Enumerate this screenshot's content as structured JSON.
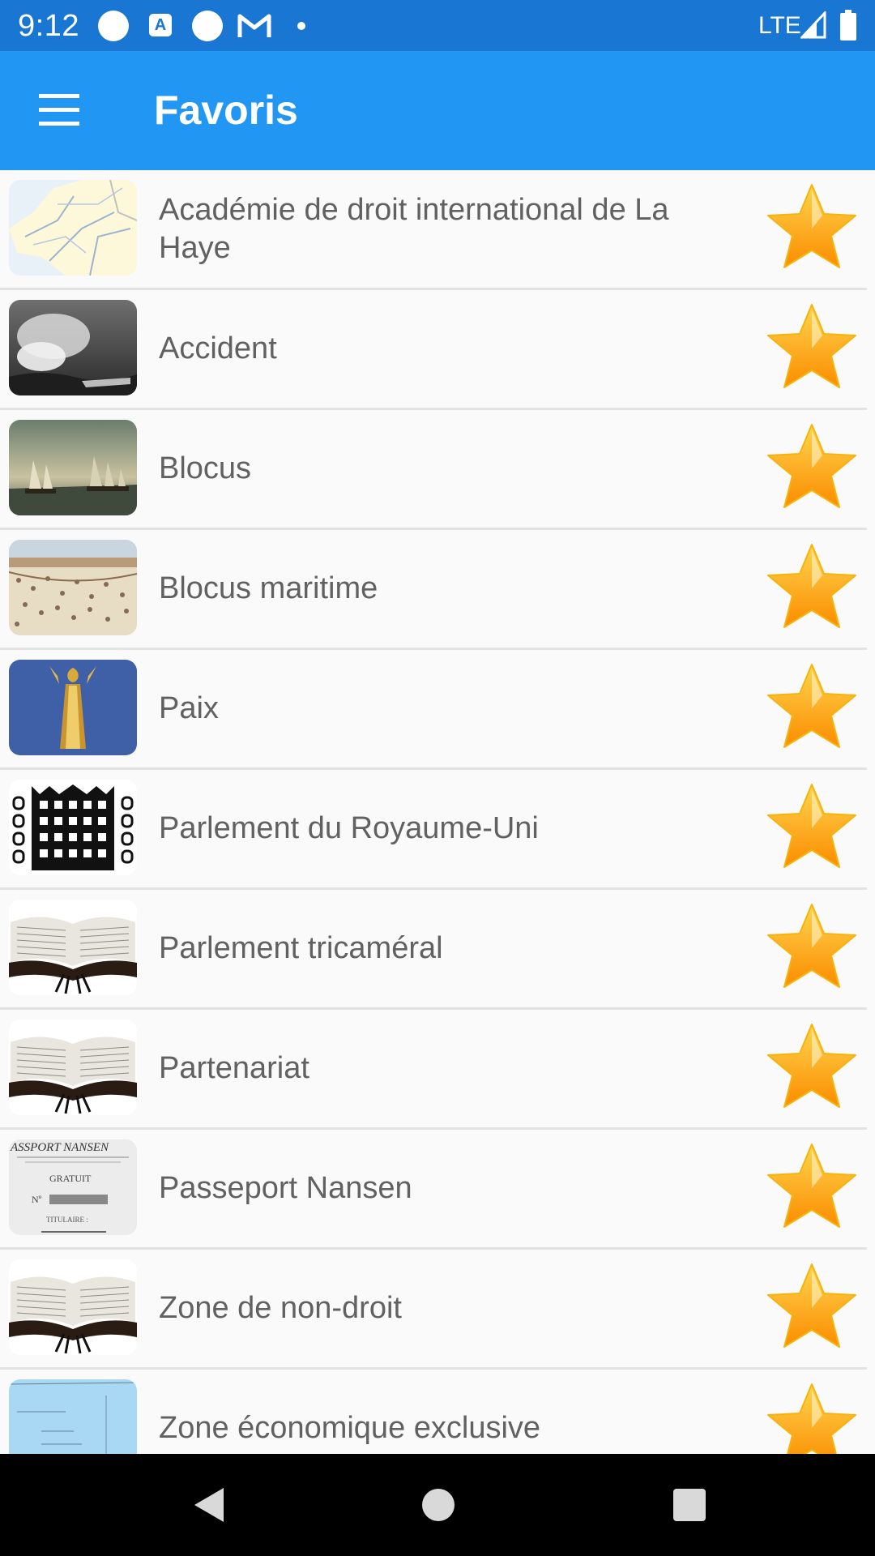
{
  "status_bar": {
    "time": "9:12",
    "a_icon_label": "A",
    "network": "LTE"
  },
  "app_bar": {
    "title": "Favoris"
  },
  "favorites": [
    {
      "label": "Académie de droit international de La Haye",
      "thumb": "map-thumbnail"
    },
    {
      "label": "Accident",
      "thumb": "ship-smoke-thumbnail"
    },
    {
      "label": "Blocus",
      "thumb": "sailing-ships-painting-thumbnail"
    },
    {
      "label": "Blocus maritime",
      "thumb": "harbor-crowd-engraving-thumbnail"
    },
    {
      "label": "Paix",
      "thumb": "golden-statue-thumbnail"
    },
    {
      "label": "Parlement du Royaume-Uni",
      "thumb": "portcullis-emblem-thumbnail"
    },
    {
      "label": "Parlement tricaméral",
      "thumb": "open-book-thumbnail"
    },
    {
      "label": "Partenariat",
      "thumb": "open-book-thumbnail"
    },
    {
      "label": "Passeport Nansen",
      "thumb": "passport-document-thumbnail"
    },
    {
      "label": "Zone de non-droit",
      "thumb": "open-book-thumbnail"
    },
    {
      "label": "Zone économique exclusive",
      "thumb": "sea-map-thumbnail"
    }
  ],
  "passport_thumb_text": {
    "line1": "ASSPORT NANSEN",
    "line2": "GRATUIT",
    "line3": "Nº",
    "line4": "TITULAIRE :"
  },
  "colors": {
    "status_bar": "#1976d2",
    "app_bar": "#2196f3",
    "star_top": "#ffd54f",
    "star_bottom": "#fb8c00",
    "label": "#616161",
    "divider": "#e3e3e3"
  }
}
